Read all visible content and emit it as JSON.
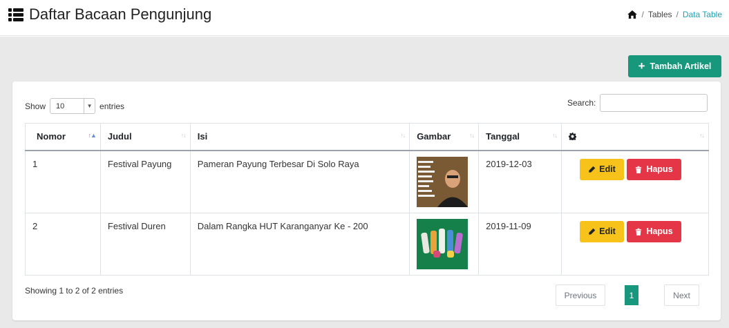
{
  "header": {
    "title": "Daftar Bacaan Pengunjung",
    "breadcrumb": [
      "Tables",
      "Data Table"
    ],
    "separator": "/"
  },
  "toolbar": {
    "add_label": "Tambah Artikel"
  },
  "datatable": {
    "show_label": "Show",
    "page_length": "10",
    "entries_label": "entries",
    "search_label": "Search:",
    "search_value": ""
  },
  "table": {
    "columns": [
      "Nomor",
      "Judul",
      "Isi",
      "Gambar",
      "Tanggal",
      ""
    ],
    "rows": [
      {
        "no": "1",
        "judul": "Festival Payung",
        "isi": "Pameran Payung Terbesar Di Solo Raya",
        "gambar": "photo-quote-man",
        "tanggal": "2019-12-03"
      },
      {
        "no": "2",
        "judul": "Festival Duren",
        "isi": "Dalam Rangka HUT Karanganyar Ke - 200",
        "gambar": "photo-colorful-socks",
        "tanggal": "2019-11-09"
      }
    ],
    "edit_label": "Edit",
    "delete_label": "Hapus"
  },
  "footer": {
    "info": "Showing 1 to 2 of 2 entries",
    "prev_label": "Previous",
    "current_page": "1",
    "next_label": "Next"
  },
  "colors": {
    "primary": "#17987d",
    "warning": "#f7c219",
    "danger": "#e53648",
    "link": "#17a2b8",
    "background": "#e9e9e9"
  },
  "icons": [
    "list-icon",
    "home-icon",
    "plus-icon",
    "gear-icon",
    "pencil-icon",
    "trash-icon",
    "sort-icon"
  ]
}
